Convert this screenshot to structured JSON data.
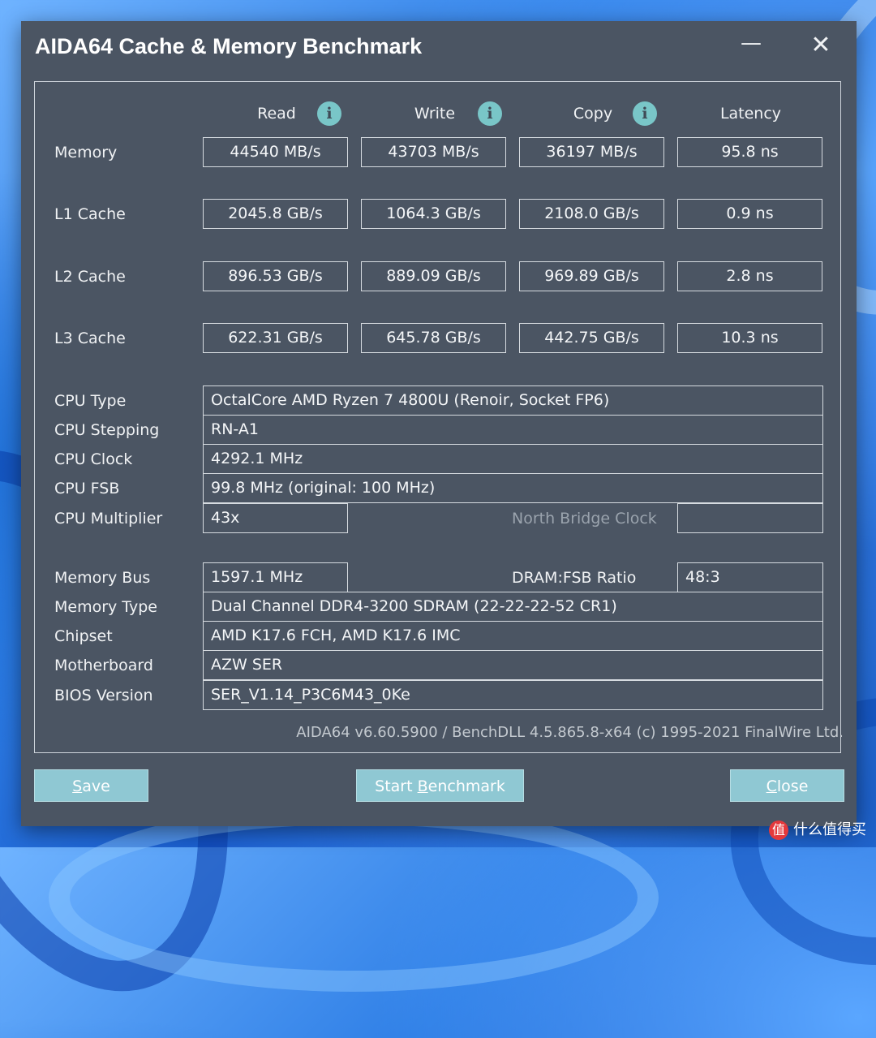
{
  "window": {
    "title": "AIDA64 Cache & Memory Benchmark",
    "minimize_glyph": "—",
    "close_glyph": "✕"
  },
  "columns": {
    "read": "Read",
    "write": "Write",
    "copy": "Copy",
    "latency": "Latency",
    "info_glyph": "i"
  },
  "bench": [
    {
      "label": "Memory",
      "read": "44540 MB/s",
      "write": "43703 MB/s",
      "copy": "36197 MB/s",
      "latency": "95.8 ns"
    },
    {
      "label": "L1 Cache",
      "read": "2045.8 GB/s",
      "write": "1064.3 GB/s",
      "copy": "2108.0 GB/s",
      "latency": "0.9 ns"
    },
    {
      "label": "L2 Cache",
      "read": "896.53 GB/s",
      "write": "889.09 GB/s",
      "copy": "969.89 GB/s",
      "latency": "2.8 ns"
    },
    {
      "label": "L3 Cache",
      "read": "622.31 GB/s",
      "write": "645.78 GB/s",
      "copy": "442.75 GB/s",
      "latency": "10.3 ns"
    }
  ],
  "cpu": {
    "type_label": "CPU Type",
    "type_value": "OctalCore AMD Ryzen 7 4800U  (Renoir, Socket FP6)",
    "stepping_label": "CPU Stepping",
    "stepping_value": "RN-A1",
    "clock_label": "CPU Clock",
    "clock_value": "4292.1 MHz",
    "fsb_label": "CPU FSB",
    "fsb_value": "99.8 MHz  (original: 100 MHz)",
    "multiplier_label": "CPU Multiplier",
    "multiplier_value": "43x",
    "nb_clock_label": "North Bridge Clock",
    "nb_clock_value": ""
  },
  "memory": {
    "bus_label": "Memory Bus",
    "bus_value": "1597.1 MHz",
    "ratio_label": "DRAM:FSB Ratio",
    "ratio_value": "48:3",
    "type_label": "Memory Type",
    "type_value": "Dual Channel DDR4-3200 SDRAM  (22-22-22-52 CR1)",
    "chipset_label": "Chipset",
    "chipset_value": "AMD K17.6 FCH, AMD K17.6 IMC",
    "motherboard_label": "Motherboard",
    "motherboard_value": "AZW SER",
    "bios_label": "BIOS Version",
    "bios_value": "SER_V1.14_P3C6M43_0Ke"
  },
  "footer": "AIDA64 v6.60.5900 / BenchDLL 4.5.865.8-x64  (c) 1995-2021 FinalWire Ltd.",
  "buttons": {
    "save_hotkey": "S",
    "save_rest": "ave",
    "start_pre": "Start ",
    "start_hotkey": "B",
    "start_rest": "enchmark",
    "close_hotkey": "C",
    "close_rest": "lose"
  },
  "watermark": {
    "icon": "值",
    "text": "什么值得买"
  },
  "colors": {
    "window_bg": "#4b5563",
    "info_icon": "#79c6c8",
    "button_bg": "#8fc8d3"
  }
}
